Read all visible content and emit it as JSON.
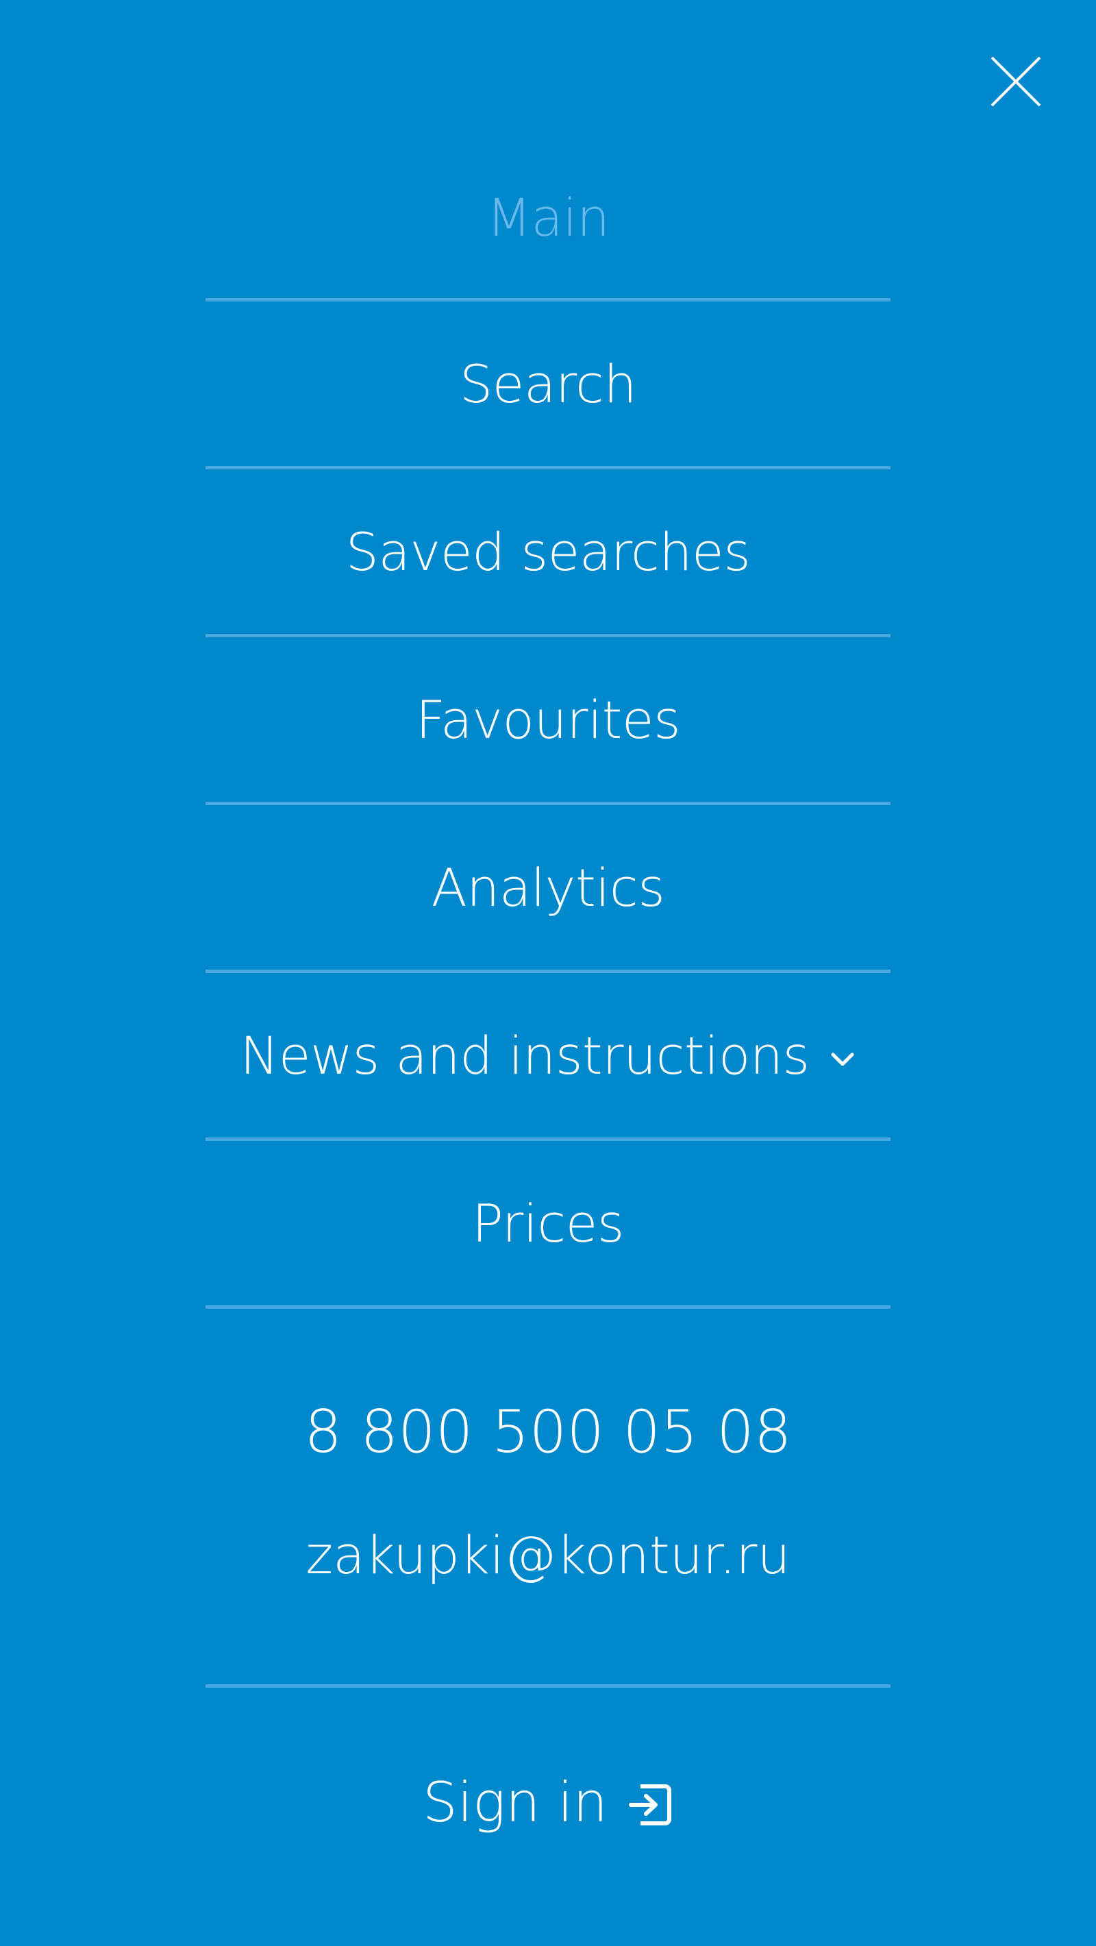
{
  "header": {
    "close_icon": "close-icon"
  },
  "menu": {
    "items": [
      {
        "label": "Main",
        "active": true
      },
      {
        "label": "Search"
      },
      {
        "label": "Saved searches"
      },
      {
        "label": "Favourites"
      },
      {
        "label": "Analytics"
      },
      {
        "label": "News and instructions",
        "icon": "chevron-down-icon"
      },
      {
        "label": "Prices"
      }
    ]
  },
  "contacts": {
    "phone": "8 800 500 05 08",
    "email": "zakupki@kontur.ru"
  },
  "auth": {
    "signin_label": "Sign in",
    "signin_icon": "sign-in-icon"
  },
  "colors": {
    "background": "#0088cc",
    "divider": "#4ba7e0",
    "active_item": "#6ab9ec",
    "text": "#ffffff"
  }
}
